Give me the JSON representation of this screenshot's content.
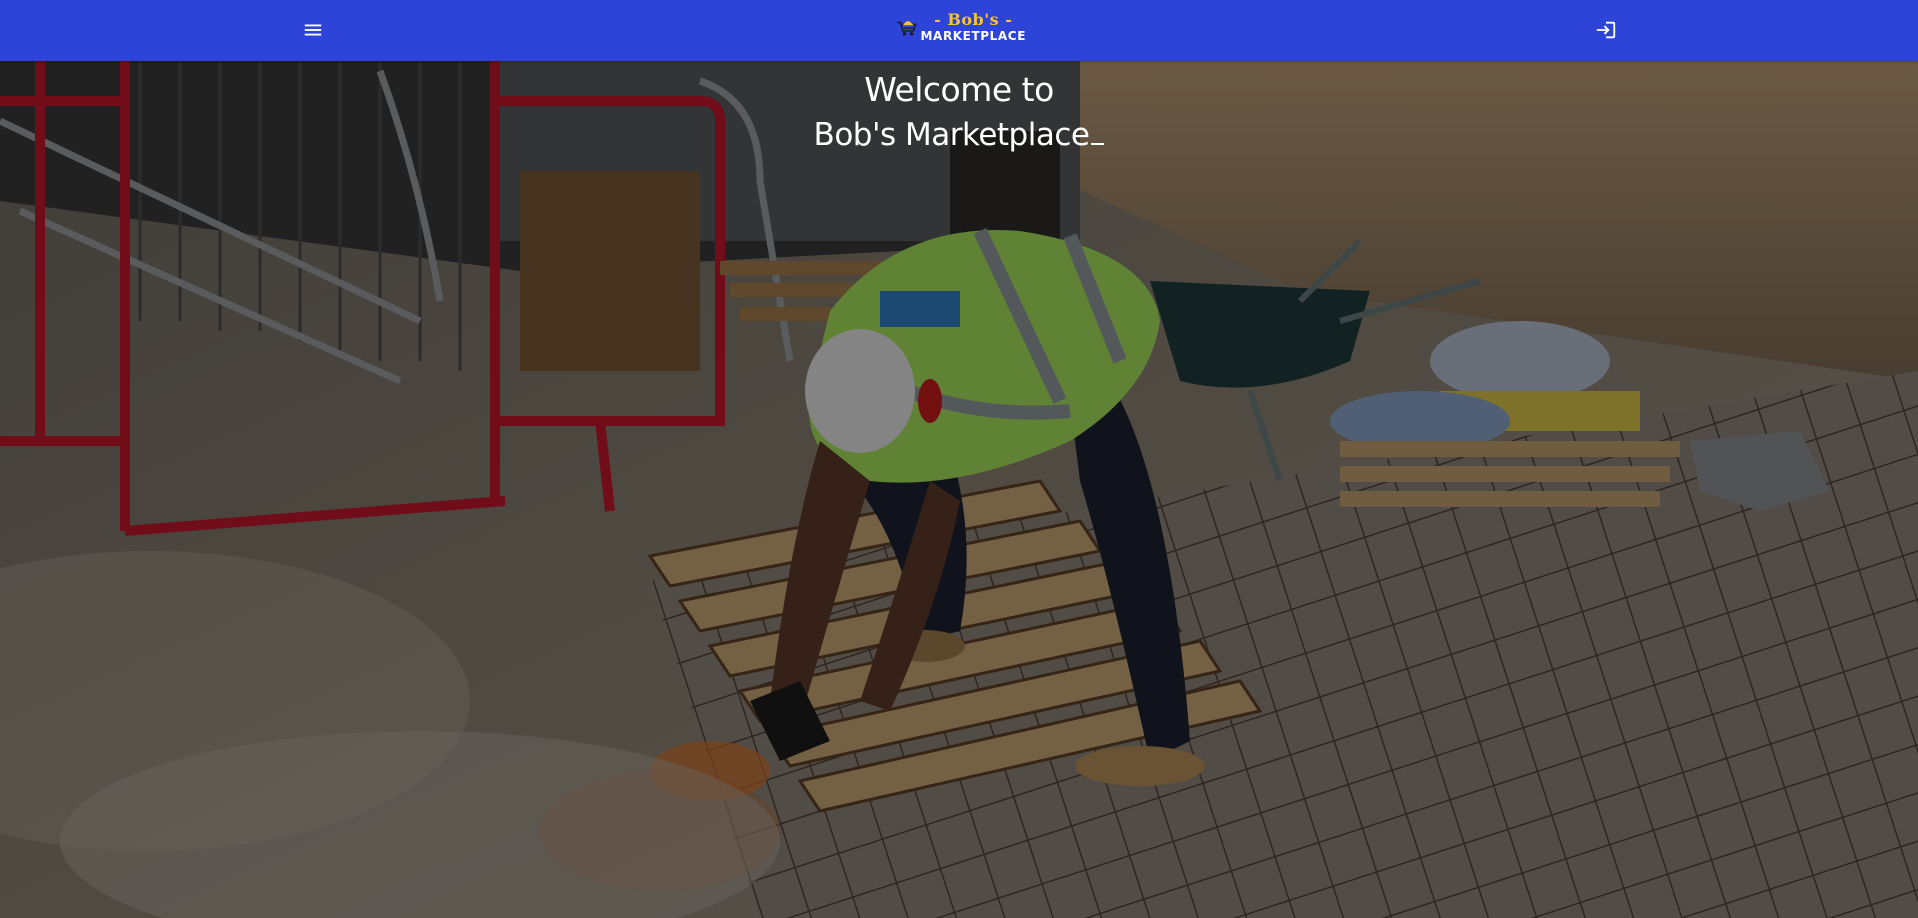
{
  "header": {
    "brand_line1": "- Bob's -",
    "brand_line2": "MARKETPLACE",
    "menu_icon": "menu-icon",
    "login_icon": "login-icon",
    "background_color": "#2e44d8",
    "brand_accent_color": "#f6c431"
  },
  "hero": {
    "title_line1": "Welcome to",
    "title_line2": "Bob's Marketplace",
    "cursor_glyph": "_"
  }
}
